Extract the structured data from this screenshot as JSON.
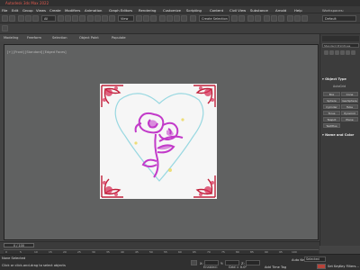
{
  "window": {
    "title": "Autodesk 3ds Max 2022"
  },
  "menu": [
    "File",
    "Edit",
    "Group",
    "Views",
    "Create",
    "Modifiers",
    "Animation",
    "Graph Editors",
    "Rendering",
    "Customize",
    "Scripting",
    "Content",
    "Civil View",
    "Substance",
    "Arnold",
    "Help"
  ],
  "toolbar": {
    "all_dropdown": "All",
    "view_dropdown": "View",
    "selection_set_placeholder": "Create Selection Set"
  },
  "workspace": {
    "label": "Workspaces:",
    "value": "Default"
  },
  "ribbon_tabs": [
    "Modeling",
    "Freeform",
    "Selection",
    "Object Paint",
    "Populate"
  ],
  "viewport": {
    "label": "[+] [Front] [Standard] [Edged Faces]"
  },
  "command_panel": {
    "dropdown": "Standard Primitives",
    "object_type_header": "Object Type",
    "autogrid_label": "AutoGrid",
    "buttons": [
      "Box",
      "Cone",
      "Sphere",
      "GeoSphere",
      "Cylinder",
      "Tube",
      "Torus",
      "Pyramid",
      "Teapot",
      "Plane",
      "TextPlus"
    ],
    "name_color_header": "Name and Color"
  },
  "timeline": {
    "slider": "0 / 100",
    "ticks": [
      "0",
      "5",
      "10",
      "15",
      "20",
      "25",
      "30",
      "35",
      "40",
      "45",
      "50",
      "55",
      "60",
      "65",
      "70",
      "75",
      "80",
      "85",
      "90",
      "95",
      "100"
    ]
  },
  "status": {
    "selection": "None Selected",
    "prompt": "Click or click-and-drag to select objects",
    "grid": "Grid = 0.0\"",
    "add_time_tag": "Add Time Tag",
    "auto_key": "Auto Key",
    "auto_key_value": "Selected",
    "set_key": "Set Key",
    "key_filters": "Key Filters...",
    "enabled": "Enabled:",
    "x_label": "X:",
    "y_label": "Y:",
    "z_label": "Z:"
  },
  "colors": {
    "accent_red": "#e05a4e",
    "frame_red": "#c0203a",
    "flower_magenta": "#c23ac9",
    "heart_cyan": "#8fd5df"
  }
}
